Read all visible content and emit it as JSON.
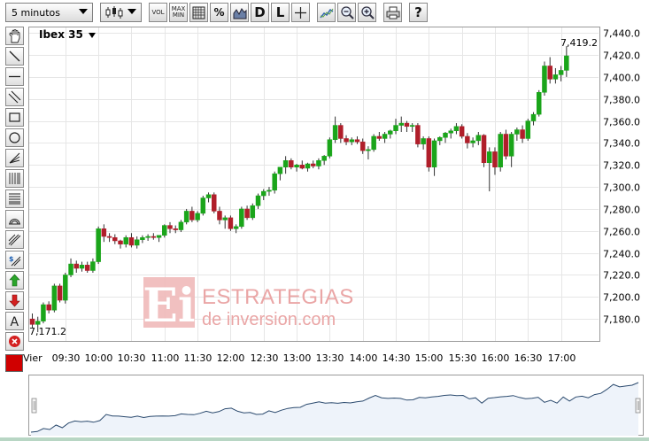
{
  "toolbar": {
    "interval_label": "5 minutos",
    "vol_label": "VOL",
    "max_label": "MAX",
    "min_label": "MIN",
    "percent_label": "%",
    "daily_label": "D",
    "line_label": "L",
    "help_label": "?"
  },
  "watermark": {
    "logo_text": "Ei",
    "line1": "ESTRATEGIAS",
    "line2": "de inversion.com"
  },
  "colors": {
    "up": "#1aa51a",
    "down": "#b01e2a",
    "grid": "#e6e6e6",
    "navigator_line": "#2b4a6e",
    "navigator_fill": "#eef3fa",
    "swatch": "#d00000"
  },
  "chart_data": {
    "type": "candlestick",
    "title": "Ibex 35",
    "first_label": "7,171.2",
    "last_label": "7,419.2",
    "ylim": [
      7160,
      7445
    ],
    "yticks": [
      7180,
      7200,
      7220,
      7240,
      7260,
      7280,
      7300,
      7320,
      7340,
      7360,
      7380,
      7400,
      7420,
      7440
    ],
    "ytick_labels": [
      "7,180.0",
      "7,200.0",
      "7,220.0",
      "7,240.0",
      "7,260.0",
      "7,280.0",
      "7,300.0",
      "7,320.0",
      "7,340.0",
      "7,360.0",
      "7,380.0",
      "7,400.0",
      "7,420.0",
      "7,440.0"
    ],
    "x_tick_labels": [
      "Vier",
      "09:30",
      "10:00",
      "10:30",
      "11:00",
      "11:30",
      "12:00",
      "12:30",
      "13:00",
      "13:30",
      "14:00",
      "14:30",
      "15:00",
      "15:30",
      "16:00",
      "16:30",
      "17:00"
    ],
    "x_tick_bar_index": [
      0,
      6,
      12,
      18,
      24,
      30,
      36,
      42,
      48,
      54,
      60,
      66,
      72,
      78,
      84,
      90,
      96
    ],
    "grid": true,
    "candles": [
      [
        7180,
        7185,
        7172,
        7175
      ],
      [
        7175,
        7182,
        7168,
        7178
      ],
      [
        7178,
        7195,
        7176,
        7193
      ],
      [
        7193,
        7196,
        7185,
        7188
      ],
      [
        7188,
        7212,
        7186,
        7210
      ],
      [
        7210,
        7212,
        7195,
        7197
      ],
      [
        7197,
        7222,
        7194,
        7220
      ],
      [
        7220,
        7235,
        7218,
        7230
      ],
      [
        7230,
        7233,
        7222,
        7226
      ],
      [
        7226,
        7232,
        7223,
        7229
      ],
      [
        7229,
        7232,
        7222,
        7224
      ],
      [
        7224,
        7235,
        7222,
        7232
      ],
      [
        7232,
        7264,
        7230,
        7262
      ],
      [
        7262,
        7266,
        7250,
        7255
      ],
      [
        7255,
        7258,
        7250,
        7254
      ],
      [
        7254,
        7257,
        7248,
        7251
      ],
      [
        7251,
        7252,
        7244,
        7248
      ],
      [
        7248,
        7256,
        7245,
        7254
      ],
      [
        7254,
        7258,
        7245,
        7247
      ],
      [
        7247,
        7255,
        7244,
        7252
      ],
      [
        7252,
        7256,
        7249,
        7254
      ],
      [
        7254,
        7257,
        7251,
        7255
      ],
      [
        7255,
        7258,
        7252,
        7254
      ],
      [
        7254,
        7256,
        7250,
        7256
      ],
      [
        7256,
        7266,
        7254,
        7265
      ],
      [
        7265,
        7268,
        7258,
        7262
      ],
      [
        7262,
        7265,
        7258,
        7261
      ],
      [
        7261,
        7270,
        7259,
        7268
      ],
      [
        7268,
        7280,
        7266,
        7278
      ],
      [
        7278,
        7282,
        7268,
        7270
      ],
      [
        7270,
        7278,
        7268,
        7276
      ],
      [
        7276,
        7292,
        7274,
        7290
      ],
      [
        7290,
        7295,
        7286,
        7293
      ],
      [
        7293,
        7295,
        7276,
        7278
      ],
      [
        7278,
        7282,
        7266,
        7270
      ],
      [
        7270,
        7274,
        7262,
        7272
      ],
      [
        7272,
        7274,
        7260,
        7262
      ],
      [
        7262,
        7266,
        7258,
        7264
      ],
      [
        7264,
        7282,
        7262,
        7280
      ],
      [
        7280,
        7283,
        7270,
        7272
      ],
      [
        7272,
        7285,
        7270,
        7283
      ],
      [
        7283,
        7294,
        7280,
        7292
      ],
      [
        7292,
        7298,
        7288,
        7296
      ],
      [
        7296,
        7300,
        7292,
        7297
      ],
      [
        7297,
        7314,
        7294,
        7312
      ],
      [
        7312,
        7318,
        7306,
        7318
      ],
      [
        7318,
        7328,
        7312,
        7324
      ],
      [
        7324,
        7326,
        7316,
        7318
      ],
      [
        7318,
        7321,
        7314,
        7320
      ],
      [
        7320,
        7324,
        7316,
        7317
      ],
      [
        7317,
        7322,
        7314,
        7321
      ],
      [
        7321,
        7324,
        7317,
        7319
      ],
      [
        7319,
        7326,
        7316,
        7324
      ],
      [
        7324,
        7329,
        7320,
        7328
      ],
      [
        7328,
        7345,
        7326,
        7343
      ],
      [
        7343,
        7364,
        7340,
        7356
      ],
      [
        7356,
        7358,
        7340,
        7344
      ],
      [
        7344,
        7347,
        7338,
        7341
      ],
      [
        7341,
        7345,
        7338,
        7343
      ],
      [
        7343,
        7346,
        7339,
        7341
      ],
      [
        7341,
        7344,
        7330,
        7333
      ],
      [
        7333,
        7337,
        7325,
        7334
      ],
      [
        7334,
        7348,
        7332,
        7346
      ],
      [
        7346,
        7350,
        7342,
        7344
      ],
      [
        7344,
        7350,
        7340,
        7348
      ],
      [
        7348,
        7352,
        7344,
        7351
      ],
      [
        7351,
        7362,
        7348,
        7356
      ],
      [
        7356,
        7364,
        7350,
        7358
      ],
      [
        7358,
        7360,
        7350,
        7355
      ],
      [
        7355,
        7358,
        7350,
        7356
      ],
      [
        7356,
        7358,
        7336,
        7339
      ],
      [
        7339,
        7346,
        7334,
        7344
      ],
      [
        7344,
        7346,
        7314,
        7318
      ],
      [
        7318,
        7344,
        7310,
        7342
      ],
      [
        7342,
        7346,
        7338,
        7345
      ],
      [
        7345,
        7350,
        7340,
        7349
      ],
      [
        7349,
        7353,
        7344,
        7351
      ],
      [
        7351,
        7358,
        7348,
        7355
      ],
      [
        7355,
        7357,
        7344,
        7346
      ],
      [
        7346,
        7349,
        7335,
        7340
      ],
      [
        7340,
        7345,
        7336,
        7342
      ],
      [
        7342,
        7350,
        7338,
        7347
      ],
      [
        7347,
        7348,
        7318,
        7322
      ],
      [
        7322,
        7336,
        7296,
        7332
      ],
      [
        7332,
        7336,
        7311,
        7318
      ],
      [
        7318,
        7350,
        7314,
        7348
      ],
      [
        7348,
        7352,
        7325,
        7328
      ],
      [
        7328,
        7350,
        7318,
        7348
      ],
      [
        7348,
        7354,
        7342,
        7352
      ],
      [
        7352,
        7356,
        7340,
        7344
      ],
      [
        7344,
        7362,
        7342,
        7360
      ],
      [
        7360,
        7368,
        7356,
        7366
      ],
      [
        7366,
        7388,
        7364,
        7386
      ],
      [
        7386,
        7414,
        7383,
        7410
      ],
      [
        7410,
        7418,
        7394,
        7398
      ],
      [
        7398,
        7408,
        7394,
        7402
      ],
      [
        7402,
        7410,
        7396,
        7406
      ],
      [
        7406,
        7428,
        7400,
        7419.2
      ]
    ]
  }
}
